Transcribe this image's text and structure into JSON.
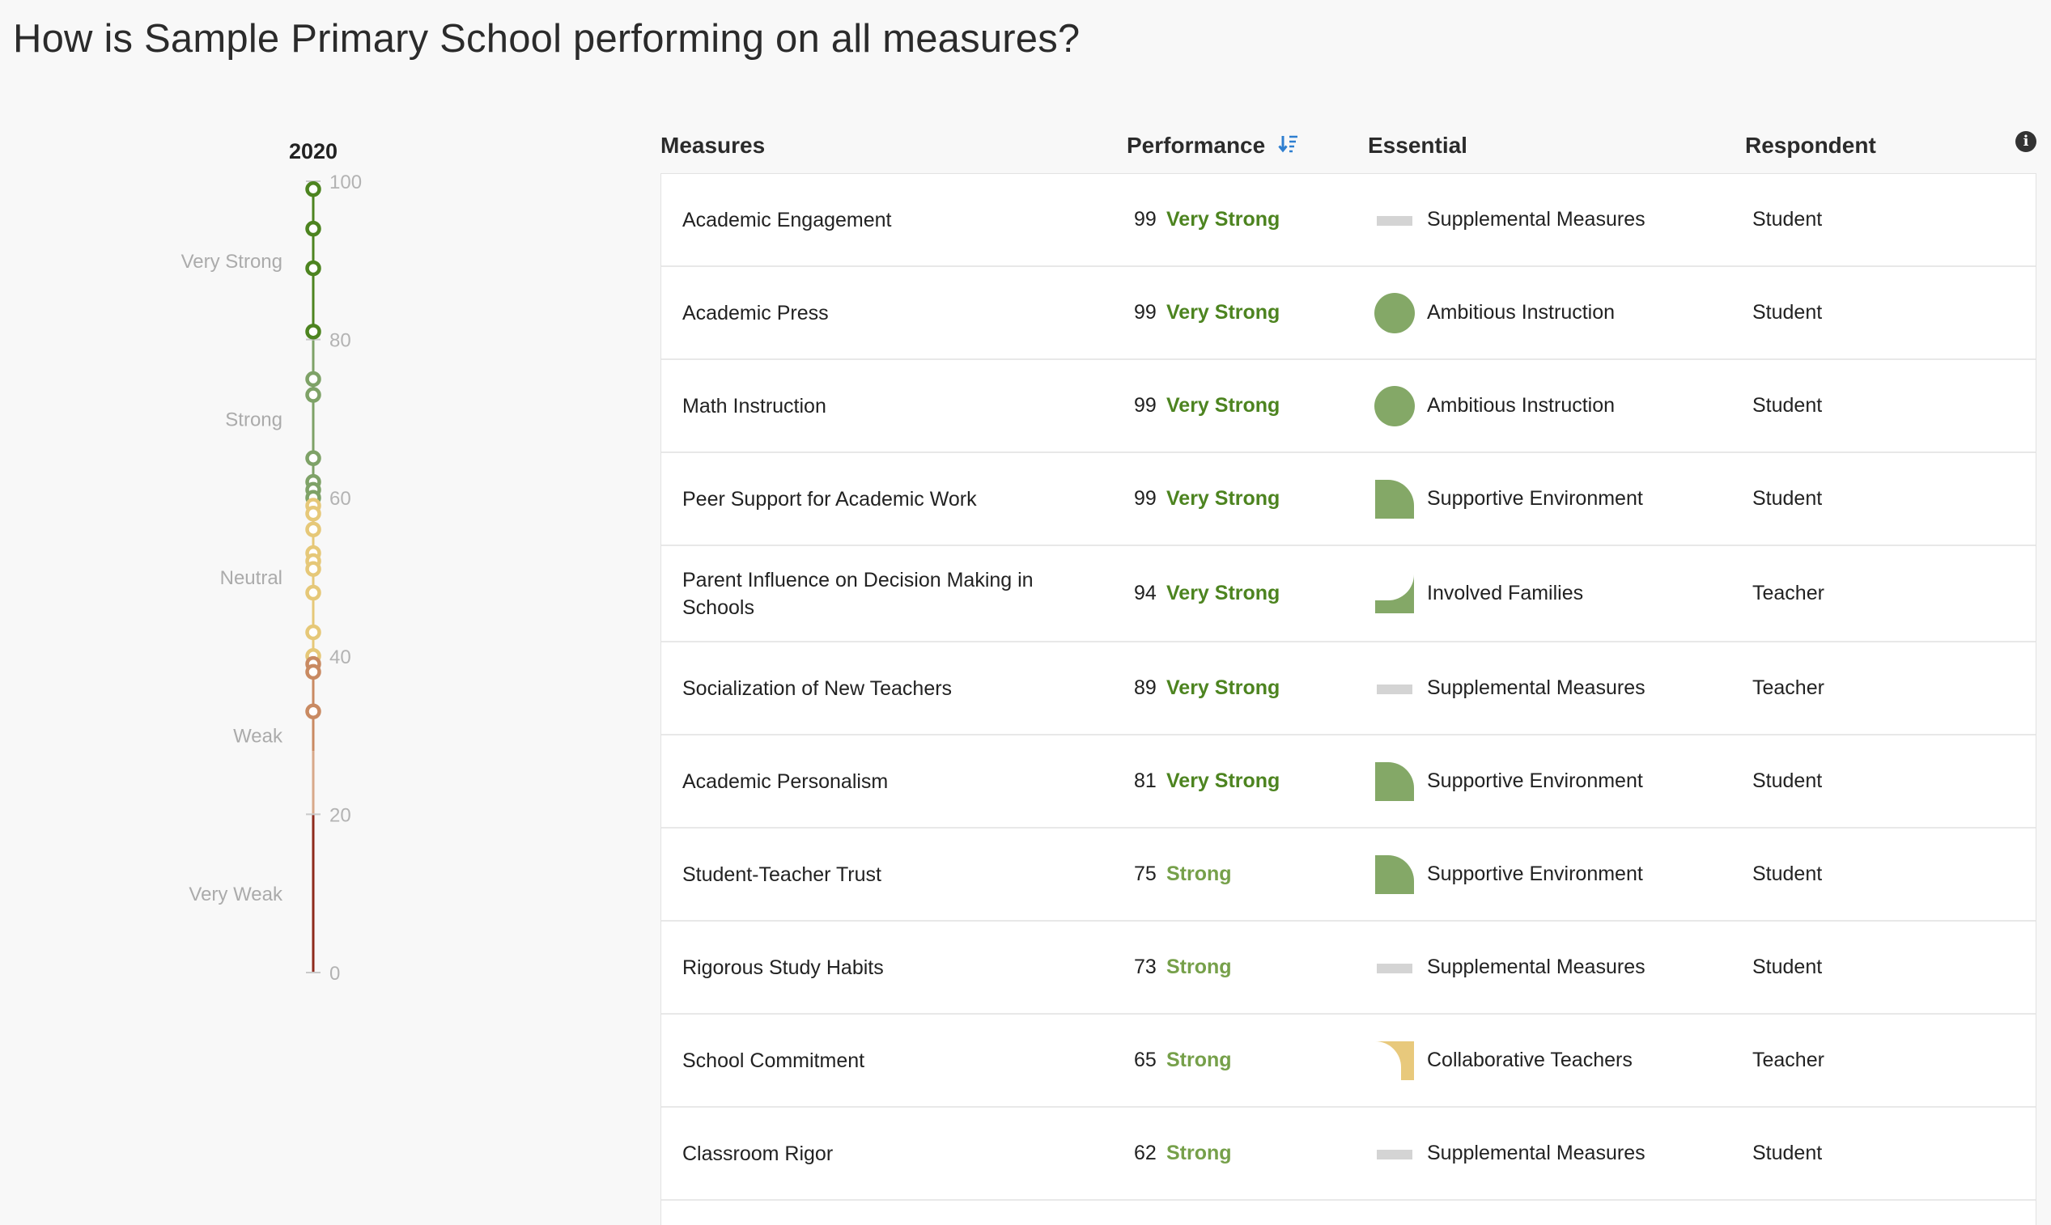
{
  "page": {
    "title": "How is Sample Primary School performing on all measures?"
  },
  "scale": {
    "year": "2020",
    "ticks": [
      "100",
      "80",
      "60",
      "40",
      "20",
      "0"
    ],
    "zones": [
      "Very Strong",
      "Strong",
      "Neutral",
      "Weak",
      "Very Weak"
    ],
    "colors": {
      "very_strong": "#4d8420",
      "strong": "#7ea267",
      "neutral": "#e6c878",
      "weak": "#c98a62",
      "very_weak": "#8e2a1c"
    },
    "points": [
      99,
      94,
      89,
      81,
      75,
      73,
      65,
      62,
      61,
      60,
      59,
      58,
      56,
      53,
      52,
      51,
      48,
      43,
      40,
      39,
      38,
      33
    ]
  },
  "table": {
    "headers": {
      "measures": "Measures",
      "performance": "Performance",
      "essential": "Essential",
      "respondent": "Respondent"
    },
    "icons": {
      "sort": "sort-descending-icon",
      "info": "info-icon"
    },
    "rows": [
      {
        "measure": "Academic Engagement",
        "score": "99",
        "level": "Very Strong",
        "level_key": "very-strong",
        "essential": "Supplemental Measures",
        "essential_icon": "supplemental-bar-icon",
        "respondent": "Student"
      },
      {
        "measure": "Academic Press",
        "score": "99",
        "level": "Very Strong",
        "level_key": "very-strong",
        "essential": "Ambitious Instruction",
        "essential_icon": "circle-icon",
        "respondent": "Student"
      },
      {
        "measure": "Math Instruction",
        "score": "99",
        "level": "Very Strong",
        "level_key": "very-strong",
        "essential": "Ambitious Instruction",
        "essential_icon": "circle-icon",
        "respondent": "Student"
      },
      {
        "measure": "Peer Support for Academic Work",
        "score": "99",
        "level": "Very Strong",
        "level_key": "very-strong",
        "essential": "Supportive Environment",
        "essential_icon": "supportive-shape-icon",
        "respondent": "Student"
      },
      {
        "measure": "Parent Influence on Decision Making in Schools",
        "score": "94",
        "level": "Very Strong",
        "level_key": "very-strong",
        "essential": "Involved Families",
        "essential_icon": "families-shape-icon",
        "respondent": "Teacher"
      },
      {
        "measure": "Socialization of New Teachers",
        "score": "89",
        "level": "Very Strong",
        "level_key": "very-strong",
        "essential": "Supplemental Measures",
        "essential_icon": "supplemental-bar-icon",
        "respondent": "Teacher"
      },
      {
        "measure": "Academic Personalism",
        "score": "81",
        "level": "Very Strong",
        "level_key": "very-strong",
        "essential": "Supportive Environment",
        "essential_icon": "supportive-shape-icon",
        "respondent": "Student"
      },
      {
        "measure": "Student-Teacher Trust",
        "score": "75",
        "level": "Strong",
        "level_key": "strong",
        "essential": "Supportive Environment",
        "essential_icon": "supportive-shape-icon",
        "respondent": "Student"
      },
      {
        "measure": "Rigorous Study Habits",
        "score": "73",
        "level": "Strong",
        "level_key": "strong",
        "essential": "Supplemental Measures",
        "essential_icon": "supplemental-bar-icon",
        "respondent": "Student"
      },
      {
        "measure": "School Commitment",
        "score": "65",
        "level": "Strong",
        "level_key": "strong",
        "essential": "Collaborative Teachers",
        "essential_icon": "collaborative-shape-icon",
        "respondent": "Teacher"
      },
      {
        "measure": "Classroom Rigor",
        "score": "62",
        "level": "Strong",
        "level_key": "strong",
        "essential": "Supplemental Measures",
        "essential_icon": "supplemental-bar-icon",
        "respondent": "Student"
      }
    ]
  }
}
